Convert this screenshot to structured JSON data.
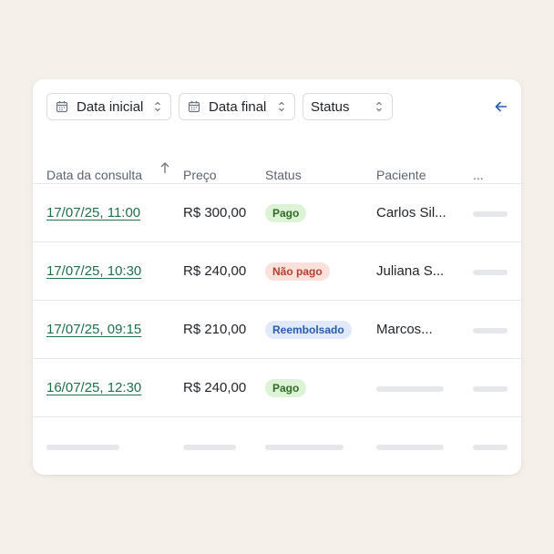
{
  "filters": [
    {
      "label": "Data inicial",
      "icon": "calendar-icon"
    },
    {
      "label": "Data final",
      "icon": "calendar-icon"
    },
    {
      "label": "Status"
    }
  ],
  "back_icon": "arrow-left-icon",
  "columns": {
    "date": "Data da consulta",
    "price": "Preço",
    "status": "Status",
    "patient": "Paciente",
    "more": "..."
  },
  "rows": [
    {
      "date": "17/07/25, 11:00",
      "price": "R$ 300,00",
      "status": "Pago",
      "patient": "Carlos Sil..."
    },
    {
      "date": "17/07/25, 10:30",
      "price": "R$ 240,00",
      "status": "Não pago",
      "patient": "Juliana S..."
    },
    {
      "date": "17/07/25, 09:15",
      "price": "R$ 210,00",
      "status": "Reembolsado",
      "patient": "Marcos..."
    },
    {
      "date": "16/07/25, 12:30",
      "price": "R$ 240,00",
      "status": "Pago",
      "patient": ""
    }
  ],
  "colors": {
    "background": "#f5f0ea",
    "link": "#1f6f4a",
    "accent": "#2b5aa8",
    "pago": "#dcf3d6",
    "nao_pago": "#fbe1dc",
    "reembolsado": "#e1eafb"
  }
}
